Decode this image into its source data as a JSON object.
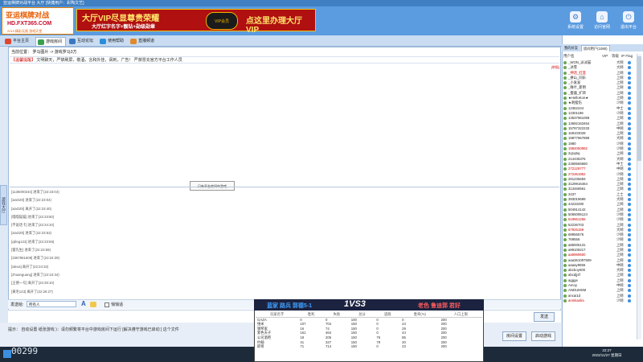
{
  "window_title": "亚运棋牌对战平台 大厅 [快捷用户：彩陶文艺]",
  "logo": {
    "line1": "亚运棋牌对战",
    "line2": "HD.FXT365.COM",
    "line3": "2019 精彩无限 游戏天堂"
  },
  "banner": {
    "headline": "大厅VIP尽显尊贵荣耀",
    "subline": "大厅红字名字+靓钻+勋级勋章",
    "badge": "VIP会员",
    "cta": "点这里办理大厅VIP"
  },
  "top_buttons": [
    {
      "label": "系统设置",
      "icon": "gear-icon"
    },
    {
      "label": "访问官网",
      "icon": "home-icon"
    },
    {
      "label": "退出平台",
      "icon": "exit-icon"
    }
  ],
  "nav_tabs": [
    {
      "label": "平台主页",
      "active": false
    },
    {
      "label": "游戏房间",
      "active": true
    },
    {
      "label": "互动论坛",
      "active": false
    },
    {
      "label": "使用帮助",
      "active": false
    },
    {
      "label": "直播频道",
      "active": false
    }
  ],
  "location": "当前位置： 罗马图片 -> 游戏罗马3方",
  "notice": {
    "tag": "【温馨提醒】",
    "text": "文明聊天，严禁刷屏，敬酒，言和外挂，讽刺，广告！ 严禁冒充官方平台工作人员"
  },
  "report_link": "[举报]",
  "popup": "只有平台房间中游戏",
  "side_tab": "游戏大厅",
  "chat_log": [
    "[1135000244] 进来了(22:23:04)",
    "[xiaOZ0] 进来了(22:23:04)",
    "[xiaOZ0] 离开了(22:23:40)",
    "[喵喵猫猫] 进来了(22:23:50)",
    "[不说话卡] 进来了(22:24:10)",
    "[xiaOZ0] 进来了(22:23:53)",
    "[qiling123] 进来了(22:23:59)",
    "[雷先生] 进来了(22:23:59)",
    "[3367961608] 进来了(22:24:29)",
    "[alexa] 离开了(22:24:32)",
    "[zhuanguang] 进来了(22:24:34)",
    "[王德一号] 离开了(22:25:10)",
    "[黄毛123] 离开了(22:26:27)"
  ],
  "input": {
    "send_label": "发送给:",
    "target": "所有人",
    "private_label": "悄悄话",
    "send_button": "发送"
  },
  "bottom": {
    "status_text": "提示：  自动设置     纸张游戏   )：请勿频繁将平台中游戏房间下运行 [解决遵守游戏已启动 ] 这个文件",
    "room_settings": "房间设置",
    "start_game": "启动游戏"
  },
  "counter": "00299",
  "clock": {
    "time": "22:27",
    "date": "2022/11/27 星期日"
  },
  "scoreboard": {
    "blue_team": "蓝家 路兵 郭德5-1",
    "vs": "1VS3",
    "red_team": "老色 鲁迪郭 君好",
    "headers": [
      "玩家名字",
      "胜利",
      "失败",
      "总分",
      "逃跑",
      "胜率(%)",
      "人口上限"
    ],
    "rows": [
      [
        "GAZA",
        "0",
        "0",
        "100",
        "0",
        "0",
        "200"
      ],
      [
        "维米",
        "107",
        "704",
        "150",
        "0",
        "24",
        "200"
      ],
      [
        "钢琴家",
        "16",
        "74",
        "150",
        "0",
        "29",
        "200"
      ],
      [
        "紫色天子",
        "161",
        "464",
        "150",
        "0",
        "44",
        "200"
      ],
      [
        "公司酒吧",
        "18",
        "205",
        "150",
        "76",
        "85",
        "200"
      ],
      [
        "约翰",
        "41",
        "327",
        "150",
        "79",
        "20",
        "200"
      ],
      [
        "即将",
        "71",
        "714",
        "150",
        "0",
        "23",
        "200"
      ]
    ]
  },
  "right_panel": {
    "tabs": [
      "我的好友",
      "房间用户(1080)"
    ],
    "header": {
      "name": "用户名",
      "vip": "VIP",
      "rank": "等级",
      "flag": "IP Flag"
    },
    "users": [
      {
        "name": "_WON_派派猫",
        "rank": "大网",
        "color": "#222"
      },
      {
        "name": "_冰雪",
        "rank": "大网",
        "color": "#222"
      },
      {
        "name": "_神话_红莲",
        "rank": "上网",
        "color": "#c00"
      },
      {
        "name": "_拼山_同乐",
        "rank": "上网",
        "color": "#222"
      },
      {
        "name": "_小发发",
        "rank": "上网",
        "color": "#222"
      },
      {
        "name": "_唯叶_新明",
        "rank": "上网",
        "color": "#222"
      },
      {
        "name": "_傻逼_扩转",
        "rank": "上网",
        "color": "#222"
      },
      {
        "name": "★HelloKon★",
        "rank": "上网",
        "color": "#222"
      },
      {
        "name": "★刺摆伤",
        "rank": "少网",
        "color": "#222"
      },
      {
        "name": "12362244",
        "rank": "中士",
        "color": "#222"
      },
      {
        "name": "12301196",
        "rank": "少网",
        "color": "#222"
      },
      {
        "name": "13537961059",
        "rank": "上网",
        "color": "#222"
      },
      {
        "name": "13692163464",
        "rank": "上网",
        "color": "#222"
      },
      {
        "name": "15797322233",
        "rank": "中网",
        "color": "#222"
      },
      {
        "name": "169103028",
        "rank": "上网",
        "color": "#222"
      },
      {
        "name": "19877967899",
        "rank": "大网",
        "color": "#222"
      },
      {
        "name": "1980",
        "rank": "少网",
        "color": "#222"
      },
      {
        "name": "1984050992",
        "rank": "少网",
        "color": "#c00"
      },
      {
        "name": "2q1q6q",
        "rank": "上网",
        "color": "#222"
      },
      {
        "name": "214435376",
        "rank": "大网",
        "color": "#222"
      },
      {
        "name": "2468565660",
        "rank": "中士",
        "color": "#222"
      },
      {
        "name": "272129777",
        "rank": "中网",
        "color": "#c00"
      },
      {
        "name": "272361952",
        "rank": "少网",
        "color": "#c00"
      },
      {
        "name": "281235693",
        "rank": "上网",
        "color": "#222"
      },
      {
        "name": "3129916464",
        "rank": "上网",
        "color": "#222"
      },
      {
        "name": "313469561",
        "rank": "上网",
        "color": "#222"
      },
      {
        "name": "3437",
        "rank": "上士",
        "color": "#222"
      },
      {
        "name": "393019699",
        "rank": "大网",
        "color": "#222"
      },
      {
        "name": "44233290",
        "rank": "上网",
        "color": "#222"
      },
      {
        "name": "504914142",
        "rank": "上网",
        "color": "#222"
      },
      {
        "name": "5065095124",
        "rank": "少网",
        "color": "#222"
      },
      {
        "name": "519961256",
        "rank": "少网",
        "color": "#c00"
      },
      {
        "name": "52236703",
        "rank": "上网",
        "color": "#222"
      },
      {
        "name": "67925159",
        "rank": "大网",
        "color": "#c00"
      },
      {
        "name": "68956576",
        "rank": "少网",
        "color": "#222"
      },
      {
        "name": "769556",
        "rank": "少网",
        "color": "#222"
      },
      {
        "name": "a85005131",
        "rank": "上网",
        "color": "#222"
      },
      {
        "name": "a99109217",
        "rank": "上网",
        "color": "#222"
      },
      {
        "name": "aa5969500",
        "rank": "上网",
        "color": "#c00"
      },
      {
        "name": "aaa361097509",
        "rank": "上网",
        "color": "#222"
      },
      {
        "name": "aaaay9555",
        "rank": "中网",
        "color": "#222"
      },
      {
        "name": "abcboy000",
        "rank": "大网",
        "color": "#222"
      },
      {
        "name": "abcdjj4f",
        "rank": "上网",
        "color": "#222"
      },
      {
        "name": "aggge",
        "rank": "上网",
        "color": "#222"
      },
      {
        "name": "Amoy",
        "rank": "中网",
        "color": "#222"
      },
      {
        "name": "ANDUMSM",
        "rank": "上网",
        "color": "#222"
      },
      {
        "name": "ancai1d",
        "rank": "上网",
        "color": "#222"
      },
      {
        "name": "anmkaolia",
        "rank": "少网",
        "color": "#c00"
      }
    ]
  },
  "colors": {
    "accent": "#5b9be0",
    "banner_red": "#b01010",
    "gold": "#ffe46a",
    "blue_team": "#3ea0ff",
    "red_team": "#ff5c5c"
  }
}
